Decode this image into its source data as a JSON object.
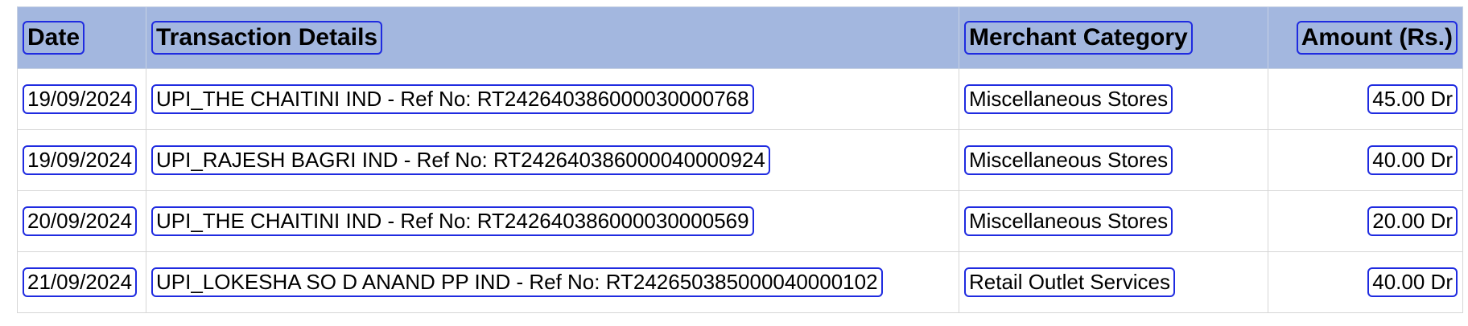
{
  "columns": {
    "date": "Date",
    "details": "Transaction Details",
    "merchant": "Merchant Category",
    "amount": "Amount (Rs.)"
  },
  "rows": [
    {
      "date": "19/09/2024",
      "details": "UPI_THE CHAITINI IND - Ref No: RT242640386000030000768",
      "merchant": "Miscellaneous Stores",
      "amount": "45.00 Dr"
    },
    {
      "date": "19/09/2024",
      "details": "UPI_RAJESH BAGRI IND - Ref No: RT242640386000040000924",
      "merchant": "Miscellaneous Stores",
      "amount": "40.00 Dr"
    },
    {
      "date": "20/09/2024",
      "details": "UPI_THE CHAITINI IND - Ref No: RT242640386000030000569",
      "merchant": "Miscellaneous Stores",
      "amount": "20.00 Dr"
    },
    {
      "date": "21/09/2024",
      "details": "UPI_LOKESHA SO D ANAND PP IND - Ref No: RT242650385000040000102",
      "merchant": "Retail Outlet Services",
      "amount": "40.00 Dr"
    }
  ],
  "colors": {
    "header_background": "#a3b7df",
    "outline": "#1f2be0"
  }
}
